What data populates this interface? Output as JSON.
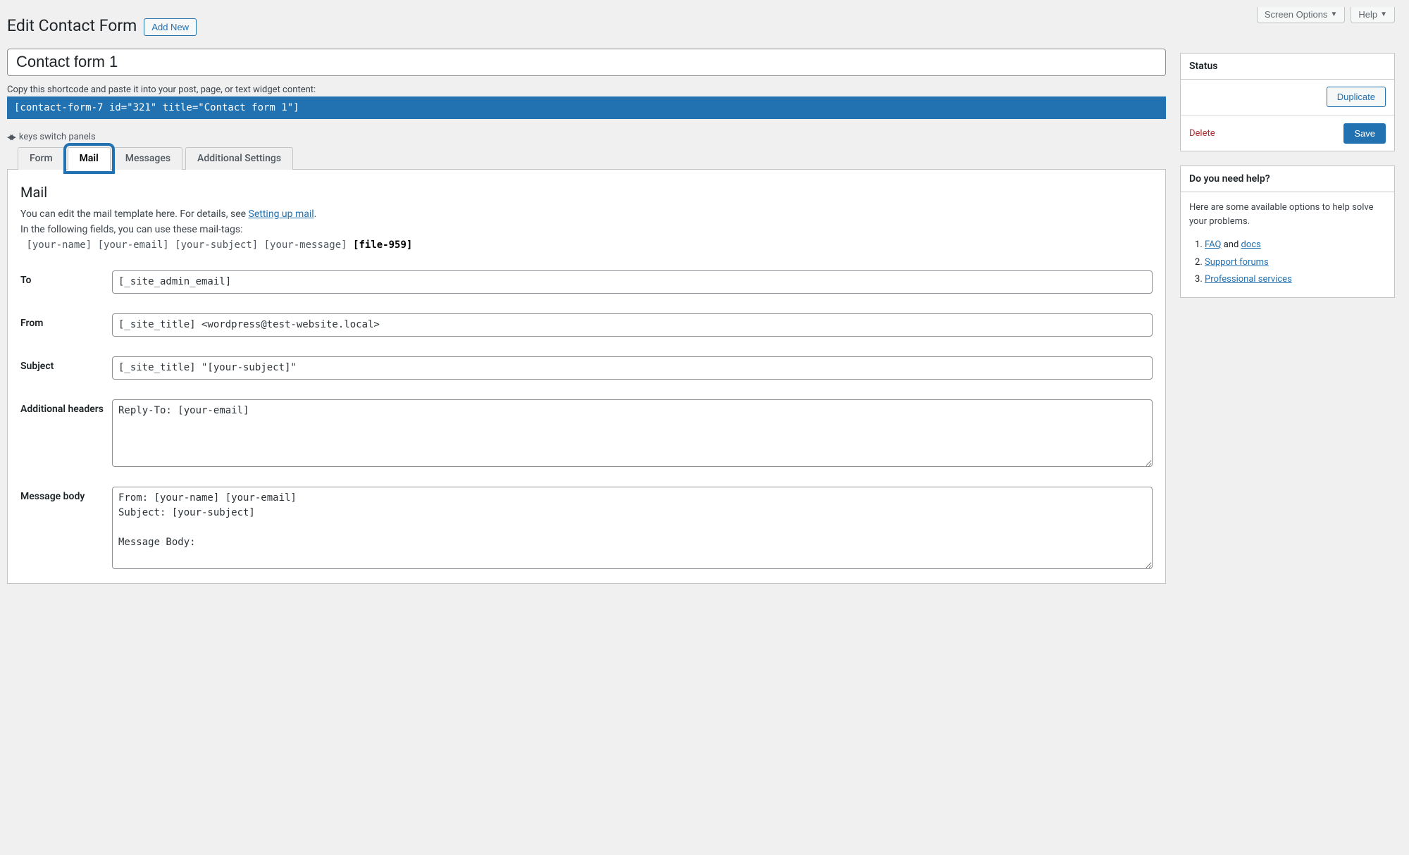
{
  "topBar": {
    "screenOptions": "Screen Options",
    "help": "Help"
  },
  "header": {
    "title": "Edit Contact Form",
    "addNew": "Add New"
  },
  "form": {
    "titleValue": "Contact form 1",
    "shortcodeHint": "Copy this shortcode and paste it into your post, page, or text widget content:",
    "shortcode": "[contact-form-7 id=\"321\" title=\"Contact form 1\"]",
    "keysHint": "keys switch panels"
  },
  "tabs": {
    "form": "Form",
    "mail": "Mail",
    "messages": "Messages",
    "additional": "Additional Settings"
  },
  "mailPanel": {
    "heading": "Mail",
    "descPrefix": "You can edit the mail template here. For details, see ",
    "settingUpLink": "Setting up mail",
    "descSuffix": ".",
    "tagsIntro": "In the following fields, you can use these mail-tags:",
    "tags": "[your-name] [your-email] [your-subject] [your-message]",
    "tagsBold": "[file-959]",
    "labels": {
      "to": "To",
      "from": "From",
      "subject": "Subject",
      "additionalHeaders": "Additional headers",
      "messageBody": "Message body"
    },
    "values": {
      "to": "[_site_admin_email]",
      "from": "[_site_title] <wordpress@test-website.local>",
      "subject": "[_site_title] \"[your-subject]\"",
      "additionalHeaders": "Reply-To: [your-email]",
      "messageBody": "From: [your-name] [your-email]\nSubject: [your-subject]\n\nMessage Body:"
    }
  },
  "status": {
    "heading": "Status",
    "duplicate": "Duplicate",
    "delete": "Delete",
    "save": "Save"
  },
  "helpBox": {
    "heading": "Do you need help?",
    "intro": "Here are some available options to help solve your problems.",
    "faq": "FAQ",
    "and": " and ",
    "docs": "docs",
    "supportForums": "Support forums",
    "professional": "Professional services"
  }
}
